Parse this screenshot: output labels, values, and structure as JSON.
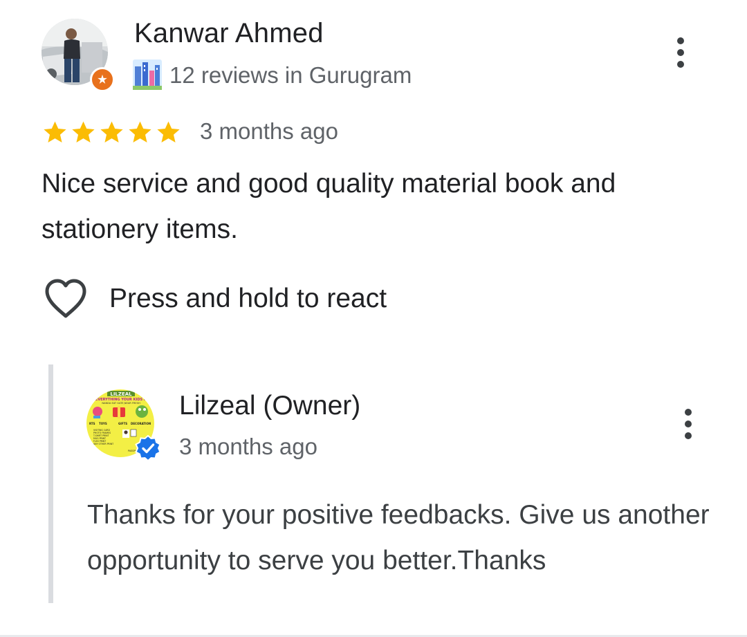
{
  "review": {
    "reviewer": {
      "name": "Kanwar Ahmed",
      "meta": "12 reviews in Gurugram",
      "avatar_icon": "profile-photo",
      "badge_icon": "local-guide-badge-icon",
      "badge_color": "#e8711c"
    },
    "rating": {
      "stars": 5,
      "max": 5,
      "star_color": "#fbbc04"
    },
    "time": "3 months ago",
    "text": "Nice service and good quality material book and stationery items.",
    "react_label": "Press and hold to react",
    "more_icon": "more-vert-icon"
  },
  "reply": {
    "owner_name": "Lilzeal (Owner)",
    "time": "3 months ago",
    "text": "Thanks for your positive feedbacks. Give us another opportunity to serve you better.Thanks",
    "logo": {
      "brand": "LILZEAL",
      "tagline": "EVERYTHING YOUR KIDS N",
      "address": "NANDA EAT GATE,NEAR FRESH",
      "categories": [
        "RTS",
        "TOYS",
        "GIFTS",
        "DECORATION"
      ],
      "services": [
        "VISITING CARD",
        "PHOTO FRAMES",
        "T-SHIRT PRINT",
        "MUG PRINT",
        "FLEX PRINT",
        "ANY OTHER PRINT"
      ],
      "passport": "PASSPORT P"
    },
    "verified_icon": "verified-check-icon",
    "verified_color": "#1a73e8"
  }
}
